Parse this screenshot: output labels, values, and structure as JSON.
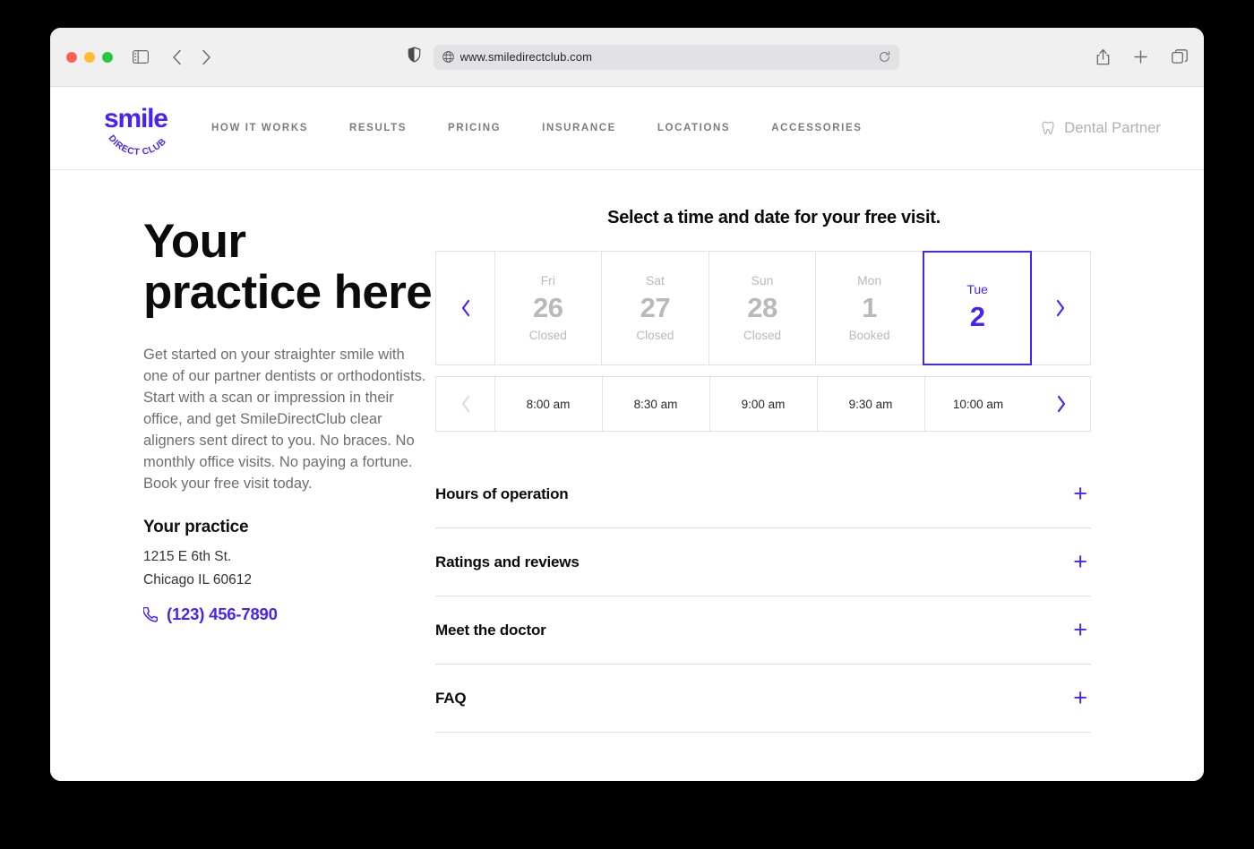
{
  "browser": {
    "url": "www.smiledirectclub.com",
    "icons": {
      "sidebar": "sidebar-toggle-icon",
      "back": "back-arrow-icon",
      "forward": "forward-arrow-icon",
      "shield": "privacy-shield-icon",
      "globe": "globe-icon",
      "reload": "reload-icon",
      "share": "share-icon",
      "new_tab": "plus-icon",
      "tabs": "tab-overview-icon"
    }
  },
  "site_header": {
    "logo": {
      "word": "smile",
      "arc": "DIRECT CLUB"
    },
    "nav": [
      {
        "label": "HOW IT WORKS"
      },
      {
        "label": "RESULTS"
      },
      {
        "label": "PRICING"
      },
      {
        "label": "INSURANCE"
      },
      {
        "label": "LOCATIONS"
      },
      {
        "label": "ACCESSORIES"
      }
    ],
    "partner": {
      "label": "Dental Partner",
      "icon": "tooth-icon"
    }
  },
  "hero": {
    "title_line1": "Your",
    "title_line2": "practice here",
    "body": "Get started on your straighter smile with one of our partner dentists or orthodontists. Start with a scan or impression in their office, and get SmileDirectClub clear aligners sent direct to you. No braces. No monthly office visits. No paying a fortune. Book your free visit today.",
    "practice_name": "Your practice",
    "address_line1": "1215 E 6th St.",
    "address_line2": "Chicago IL 60612",
    "phone": "(123) 456-7890"
  },
  "scheduler": {
    "title": "Select a time and date for your free visit.",
    "prev_label": "‹",
    "next_label": "›",
    "days": [
      {
        "dow": "Fri",
        "num": "26",
        "status": "Closed",
        "state": "closed"
      },
      {
        "dow": "Sat",
        "num": "27",
        "status": "Closed",
        "state": "closed"
      },
      {
        "dow": "Sun",
        "num": "28",
        "status": "Closed",
        "state": "closed"
      },
      {
        "dow": "Mon",
        "num": "1",
        "status": "Booked",
        "state": "booked"
      },
      {
        "dow": "Tue",
        "num": "2",
        "status": "",
        "state": "selected"
      }
    ],
    "times": [
      {
        "label": "8:00 am"
      },
      {
        "label": "8:30 am"
      },
      {
        "label": "9:00 am"
      },
      {
        "label": "9:30 am"
      },
      {
        "label": "10:00 am"
      }
    ]
  },
  "accordion": [
    {
      "label": "Hours of operation",
      "toggle": "+"
    },
    {
      "label": "Ratings and reviews",
      "toggle": "+"
    },
    {
      "label": "Meet the doctor",
      "toggle": "+"
    },
    {
      "label": "FAQ",
      "toggle": "+"
    }
  ],
  "colors": {
    "brand_purple": "#4b22f4",
    "text_dark": "#0b0b0b",
    "muted_gray": "#b9b9b9"
  }
}
